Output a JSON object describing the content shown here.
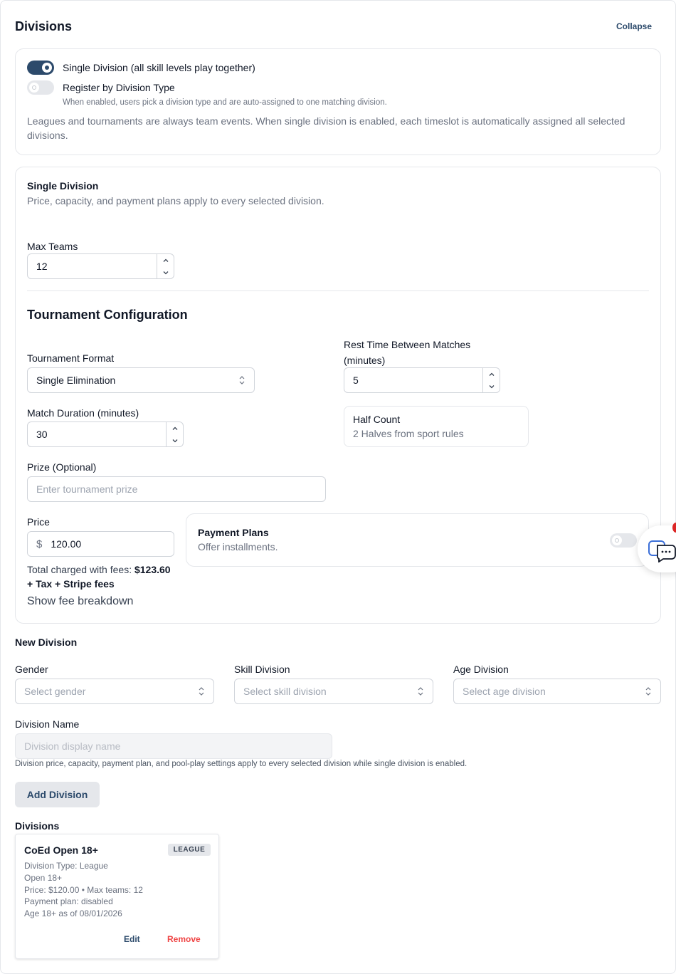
{
  "header": {
    "title": "Divisions",
    "collapse_label": "Collapse"
  },
  "division_mode": {
    "single_toggle_on": true,
    "single_label": "Single Division (all skill levels play together)",
    "register_toggle_on": false,
    "register_label": "Register by Division Type",
    "register_hint": "When enabled, users pick a division type and are auto-assigned to one matching division.",
    "info_text": "Leagues and tournaments are always team events. When single division is enabled, each timeslot is automatically assigned all selected divisions."
  },
  "single_division": {
    "title": "Single Division",
    "subtitle": "Price, capacity, and payment plans apply to every selected division.",
    "max_teams_label": "Max Teams",
    "max_teams_value": "12"
  },
  "tournament": {
    "title": "Tournament Configuration",
    "format_label": "Tournament Format",
    "format_value": "Single Elimination",
    "rest_label": "Rest Time Between Matches (minutes)",
    "rest_value": "5",
    "duration_label": "Match Duration (minutes)",
    "duration_value": "30",
    "half_count_title": "Half Count",
    "half_count_value": "2 Halves from sport rules",
    "prize_label": "Prize (Optional)",
    "prize_placeholder": "Enter tournament prize",
    "price_label": "Price",
    "currency_symbol": "$",
    "price_value": "120.00",
    "total_prefix": "Total charged with fees: ",
    "total_value": "$123.60",
    "tax_note": "+ Tax + Stripe fees",
    "fee_breakdown_link": "Show fee breakdown",
    "payment_plans_title": "Payment Plans",
    "payment_plans_subtitle": "Offer installments.",
    "payment_plans_on": false
  },
  "new_division": {
    "title": "New Division",
    "gender_label": "Gender",
    "gender_placeholder": "Select gender",
    "skill_label": "Skill Division",
    "skill_placeholder": "Select skill division",
    "age_label": "Age Division",
    "age_placeholder": "Select age division",
    "name_label": "Division Name",
    "name_placeholder": "Division display name",
    "name_hint": "Division price, capacity, payment plan, and pool-play settings apply to every selected division while single division is enabled.",
    "add_button": "Add Division"
  },
  "divisions_list": {
    "title": "Divisions",
    "items": [
      {
        "name": "CoEd Open 18+",
        "badge": "LEAGUE",
        "type": "Division Type: League",
        "level": "Open 18+",
        "price_line": "Price: $120.00 • Max teams: 12",
        "payment_plan": "Payment plan: disabled",
        "age_line": "Age 18+ as of 08/01/2026",
        "edit_label": "Edit",
        "remove_label": "Remove"
      }
    ]
  },
  "colors": {
    "accent": "#2c4a6b",
    "danger": "#ef4444",
    "muted_text": "#6b7280",
    "border": "#e5e7eb"
  },
  "icons": {
    "chat": "chat-bubble-icon",
    "notification": "notification-dot-icon"
  }
}
